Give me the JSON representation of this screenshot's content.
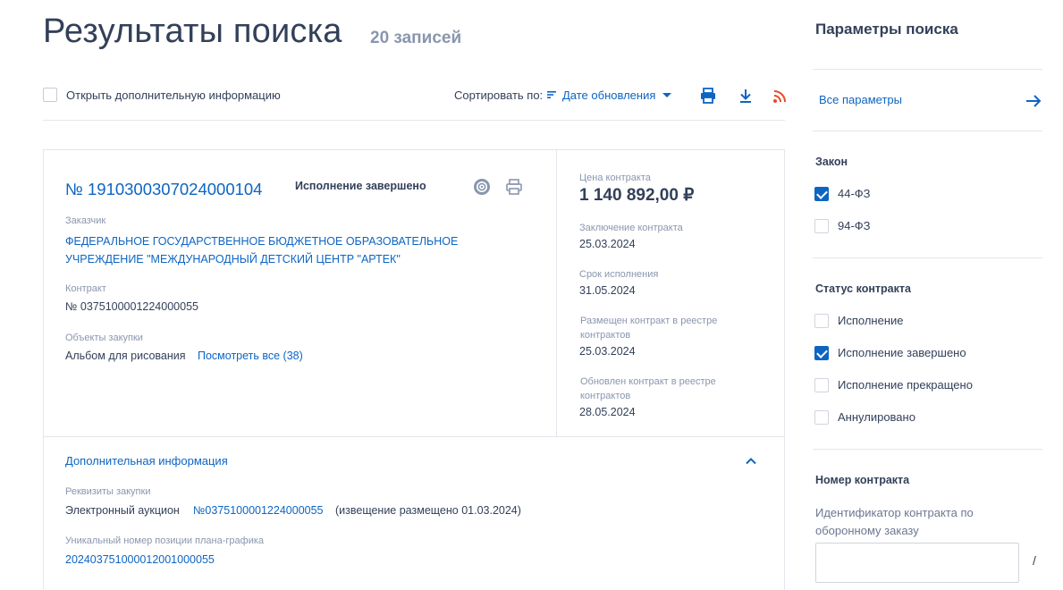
{
  "header": {
    "title": "Результаты поиска",
    "count": "20 записей"
  },
  "toolbar": {
    "extra_info_label": "Открыть дополнительную информацию",
    "sort_label": "Сортировать по:",
    "sort_value": "Дате обновления"
  },
  "card": {
    "number": "№ 1910300307024000104",
    "status": "Исполнение завершено",
    "customer_label": "Заказчик",
    "customer_value": "ФЕДЕРАЛЬНОЕ ГОСУДАРСТВЕННОЕ БЮДЖЕТНОЕ ОБРАЗОВАТЕЛЬНОЕ УЧРЕЖДЕНИЕ \"МЕЖДУНАРОДНЫЙ ДЕТСКИЙ ЦЕНТР \"АРТЕК\"",
    "contract_label": "Контракт",
    "contract_value": "№ 0375100001224000055",
    "objects_label": "Объекты закупки",
    "objects_value": "Альбом для рисования",
    "objects_link": "Посмотреть все (38)",
    "price_label": "Цена контракта",
    "price_value": "1 140 892,00 ₽",
    "conclusion_label": "Заключение контракта",
    "conclusion_value": "25.03.2024",
    "deadline_label": "Срок исполнения",
    "deadline_value": "31.05.2024",
    "placed_label": "Размещен контракт в реестре контрактов",
    "placed_value": "25.03.2024",
    "updated_label": "Обновлен контракт в реестре контрактов",
    "updated_value": "28.05.2024"
  },
  "additional": {
    "title": "Дополнительная информация",
    "requisites_label": "Реквизиты закупки",
    "auction_text": "Электронный аукцион",
    "auction_link": "№0375100001224000055",
    "auction_note": "(извещение размещено 01.03.2024)",
    "plan_label": "Уникальный номер позиции плана-графика",
    "plan_value": "202403751000012001000055"
  },
  "sidebar": {
    "title": "Параметры поиска",
    "all_params": "Все параметры",
    "law_title": "Закон",
    "law_options": [
      {
        "label": "44-ФЗ",
        "checked": true
      },
      {
        "label": "94-ФЗ",
        "checked": false
      }
    ],
    "status_title": "Статус контракта",
    "status_options": [
      {
        "label": "Исполнение",
        "checked": false
      },
      {
        "label": "Исполнение завершено",
        "checked": true
      },
      {
        "label": "Исполнение прекращено",
        "checked": false
      },
      {
        "label": "Аннулировано",
        "checked": false
      }
    ],
    "number_title": "Номер контракта",
    "defense_id_label": "Идентификатор контракта по оборонному заказу",
    "defense_id_value": "",
    "separator": "/"
  },
  "colors": {
    "accent": "#0d65c2",
    "text": "#334059",
    "muted": "#8a96ad",
    "rss": "#e8492c"
  }
}
